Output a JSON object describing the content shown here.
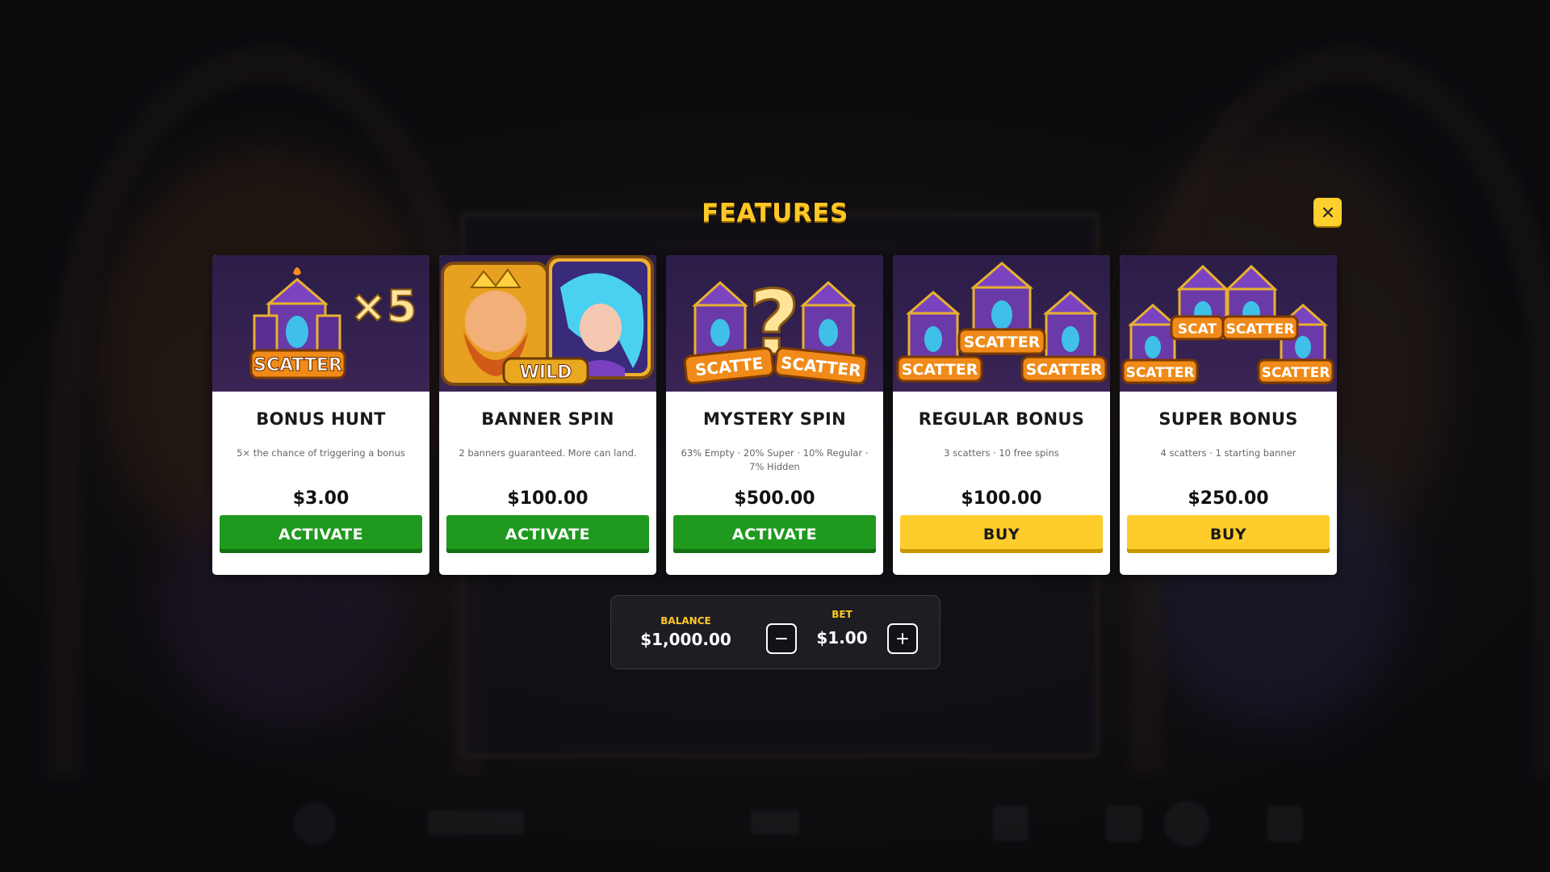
{
  "modal": {
    "title": "FEATURES",
    "close_icon": "close-icon"
  },
  "features": [
    {
      "title": "BONUS HUNT",
      "description": "5× the chance of triggering a bonus",
      "price": "$3.00",
      "action": "ACTIVATE",
      "action_type": "activate",
      "art": {
        "badge": "×5",
        "scatter_label": "SCATTER"
      }
    },
    {
      "title": "BANNER SPIN",
      "description": "2 banners guaranteed. More can land.",
      "price": "$100.00",
      "action": "ACTIVATE",
      "action_type": "activate",
      "art": {
        "wild_label": "WILD"
      }
    },
    {
      "title": "MYSTERY SPIN",
      "description": "63% Empty · 20% Super · 10% Regular · 7% Hidden",
      "price": "$500.00",
      "action": "ACTIVATE",
      "action_type": "activate",
      "art": {
        "scatter_left": "SCATTE",
        "scatter_right": "SCATTER",
        "mystery_mark": "?"
      }
    },
    {
      "title": "REGULAR BONUS",
      "description": "3 scatters · 10 free spins",
      "price": "$100.00",
      "action": "BUY",
      "action_type": "buy",
      "art": {
        "scatter_label": "SCATTER"
      }
    },
    {
      "title": "SUPER BONUS",
      "description": "4 scatters · 1 starting banner",
      "price": "$250.00",
      "action": "BUY",
      "action_type": "buy",
      "art": {
        "scatter_label": "SCATTER",
        "scatter_partial": "SCAT"
      }
    }
  ],
  "bet_panel": {
    "balance_label": "BALANCE",
    "balance_value": "$1,000.00",
    "bet_label": "BET",
    "bet_value": "$1.00",
    "decrease_icon": "minus-icon",
    "increase_icon": "plus-icon"
  },
  "colors": {
    "accent_yellow": "#ffc826",
    "activate_green": "#1f9a1f",
    "buy_yellow": "#ffcd2b",
    "art_purple": "#2b1d48"
  }
}
